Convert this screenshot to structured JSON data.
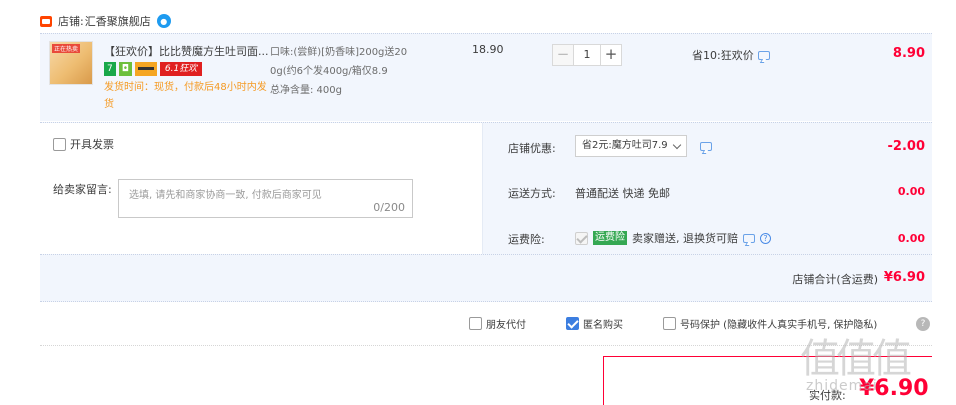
{
  "shop": {
    "label": "店铺:",
    "name": "汇香聚旗舰店",
    "ww_icon": "wangwang-icon"
  },
  "item": {
    "thumb_tag": "正在热卖",
    "title": "【狂欢价】比比赞魔方生吐司面...",
    "badges": [
      "7",
      "",
      "",
      "6.1狂欢"
    ],
    "ship_note": "发货时间：现货，付款后48小时内发货",
    "spec_lines": [
      "口味:(尝鲜)[奶香味]200g送20",
      "0g(约6个发400g/箱仅8.9",
      "总净含量: 400g"
    ],
    "unit_price": "18.90",
    "qty_minus": "−",
    "qty_plus": "+",
    "quantity": "1",
    "discount_label": "省10:狂欢价",
    "total": "8.90"
  },
  "options": {
    "invoice_label": "开具发票",
    "memo_label": "给卖家留言:",
    "memo_placeholder": "选填, 请先和商家协商一致, 付款后商家可见",
    "memo_count": "0/200",
    "coupon_label": "店铺优惠:",
    "coupon_select": "省2元:魔方吐司7.9",
    "coupon_amount": "-2.00",
    "shipping_label": "运送方式:",
    "shipping_value": "普通配送 快递 免邮",
    "shipping_amount": "0.00",
    "insurance_label": "运费险:",
    "insurance_tag": "运费险",
    "insurance_text": "卖家赠送, 退换货可赔",
    "insurance_amount": "0.00",
    "shop_total_label": "店铺合计(含运费)",
    "shop_total_amount": "¥6.90"
  },
  "extras": {
    "friend_pay": "朋友代付",
    "anonymous": "匿名购买",
    "privacy": "号码保护 (隐藏收件人真实手机号, 保护隐私)",
    "help": "?"
  },
  "payment": {
    "label": "实付款:",
    "amount": "¥6.90"
  },
  "watermark": {
    "logo": "值值值",
    "text": "zhidemai"
  },
  "colors": {
    "accent_red": "#ff0036",
    "panel_bg": "#f2f6fd",
    "link_blue": "#3c7ee0",
    "ship_orange": "#f59a23"
  }
}
